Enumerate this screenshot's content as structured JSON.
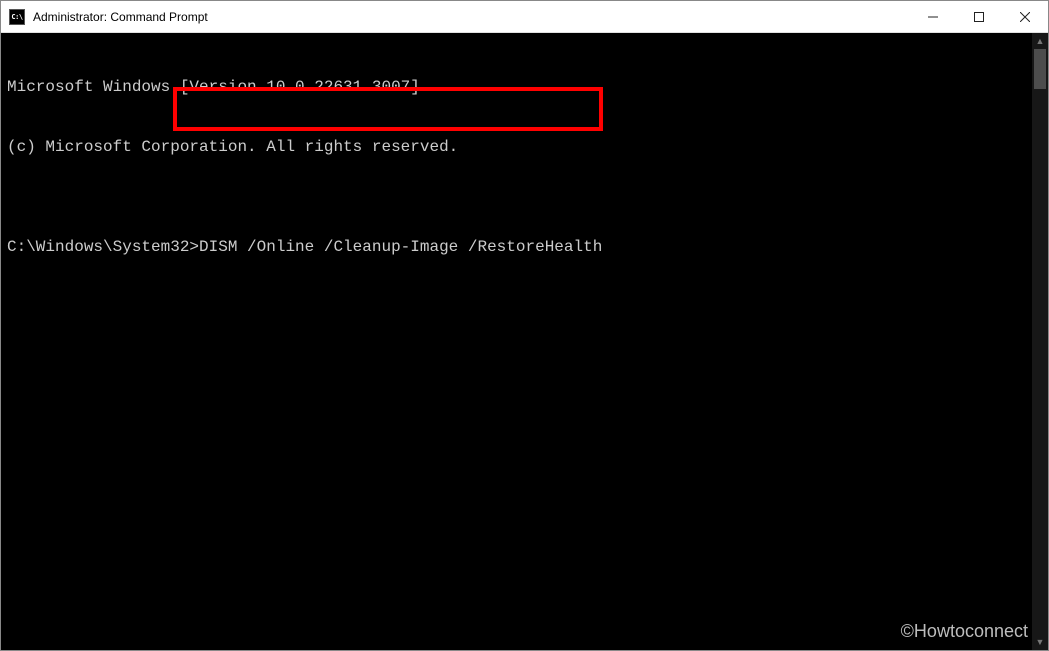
{
  "window": {
    "title": "Administrator: Command Prompt",
    "icon_label": "cmd-icon"
  },
  "terminal": {
    "line1": "Microsoft Windows [Version 10.0.22631.3007]",
    "line2": "(c) Microsoft Corporation. All rights reserved.",
    "blank": "",
    "prompt": "C:\\Windows\\System32>",
    "command": "DISM /Online /Cleanup-Image /RestoreHealth"
  },
  "watermark": "©Howtoconnect"
}
